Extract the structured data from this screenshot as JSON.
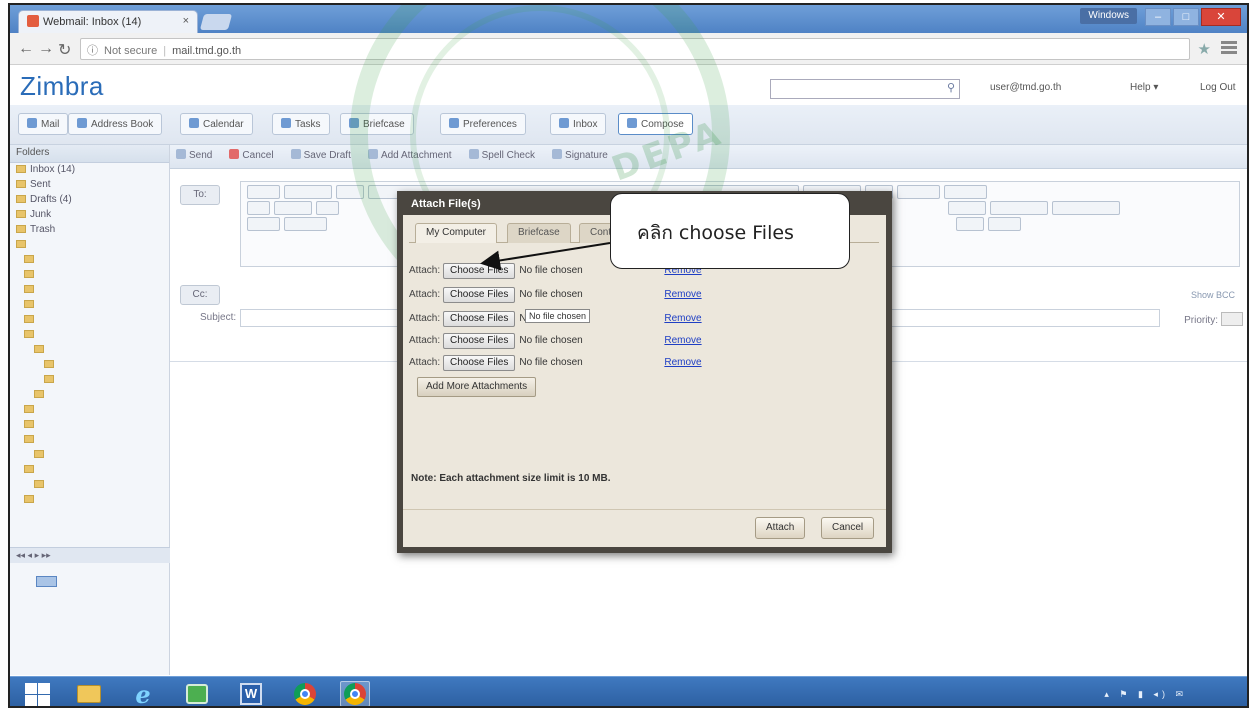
{
  "browser": {
    "tab_title": "Webmail: Inbox (14)",
    "tab_close": "×",
    "not_secure": "Not secure",
    "url": "mail.tmd.go.th",
    "user_badge": "Windows"
  },
  "zimbra": {
    "logo": "Zimbra",
    "search_placeholder": "",
    "user": "user@tmd.go.th",
    "help": "Help ▾",
    "logout": "Log Out",
    "app_tabs": [
      "Mail",
      "Address Book",
      "Calendar",
      "Tasks",
      "Briefcase",
      "Preferences",
      "Inbox",
      "Compose"
    ]
  },
  "compose_toolbar": [
    "Send",
    "Cancel",
    "Save Draft",
    "Add Attachment",
    "Spell Check",
    "Signature"
  ],
  "compose": {
    "to_label": "To:",
    "cc_label": "Cc:",
    "subject_label": "Subject:",
    "subject_value": "",
    "priority_label": "Priority:",
    "show_bcc": "Show BCC",
    "attach_hint": "",
    "body_text": ""
  },
  "left_panel": {
    "header": "Folders",
    "folders": [
      {
        "label": "Inbox (14)",
        "level": 0
      },
      {
        "label": "Sent",
        "level": 0
      },
      {
        "label": "Drafts (4)",
        "level": 0
      },
      {
        "label": "Junk",
        "level": 0
      },
      {
        "label": "Trash",
        "level": 0
      },
      {
        "label": "",
        "level": 0
      },
      {
        "label": "",
        "level": 1
      },
      {
        "label": "",
        "level": 1
      },
      {
        "label": "",
        "level": 1
      },
      {
        "label": "",
        "level": 1
      },
      {
        "label": "",
        "level": 1
      },
      {
        "label": "",
        "level": 1
      },
      {
        "label": "",
        "level": 2
      },
      {
        "label": "",
        "level": 3
      },
      {
        "label": "",
        "level": 3
      },
      {
        "label": "",
        "level": 2
      },
      {
        "label": "",
        "level": 1
      },
      {
        "label": "",
        "level": 1
      },
      {
        "label": "",
        "level": 1
      },
      {
        "label": "",
        "level": 2
      },
      {
        "label": "",
        "level": 1
      },
      {
        "label": "",
        "level": 2
      },
      {
        "label": "",
        "level": 1
      }
    ],
    "calendar_title": "",
    "calendar_days": [
      "",
      "",
      "",
      "",
      "",
      "",
      "",
      "",
      "",
      "",
      "",
      "",
      "",
      "",
      "",
      "",
      "",
      "",
      "",
      "",
      "",
      "",
      "",
      "",
      "",
      "",
      "",
      "",
      "",
      "",
      "",
      "",
      "",
      "",
      "",
      "",
      "",
      "",
      "",
      "",
      "",
      ""
    ]
  },
  "dialog": {
    "title": "Attach File(s)",
    "tabs": [
      "My Computer",
      "Briefcase",
      "Contacts"
    ],
    "rows": [
      {
        "label": "Attach:",
        "button": "Choose Files",
        "status": "No file chosen",
        "remove": "Remove"
      },
      {
        "label": "Attach:",
        "button": "Choose Files",
        "status": "No file chosen",
        "remove": "Remove"
      },
      {
        "label": "Attach:",
        "button": "Choose Files",
        "status": "No file chosen",
        "remove": "Remove"
      },
      {
        "label": "Attach:",
        "button": "Choose Files",
        "status": "No file chosen",
        "remove": "Remove"
      },
      {
        "label": "Attach:",
        "button": "Choose Files",
        "status": "No file chosen",
        "remove": "Remove"
      }
    ],
    "tooltip": "No file chosen",
    "add_more": "Add More Attachments",
    "note": "Note: Each attachment size limit is 10 MB.",
    "attach_btn": "Attach",
    "cancel_btn": "Cancel"
  },
  "callout": {
    "text": "คลิก choose Files"
  },
  "taskbar": {
    "time": "",
    "date": ""
  },
  "colors": {
    "zimbra_blue": "#2a6cb8",
    "dialog_border": "#4a4640",
    "taskbar": "#2b5d9e",
    "watermark_green": "#3ca046"
  }
}
